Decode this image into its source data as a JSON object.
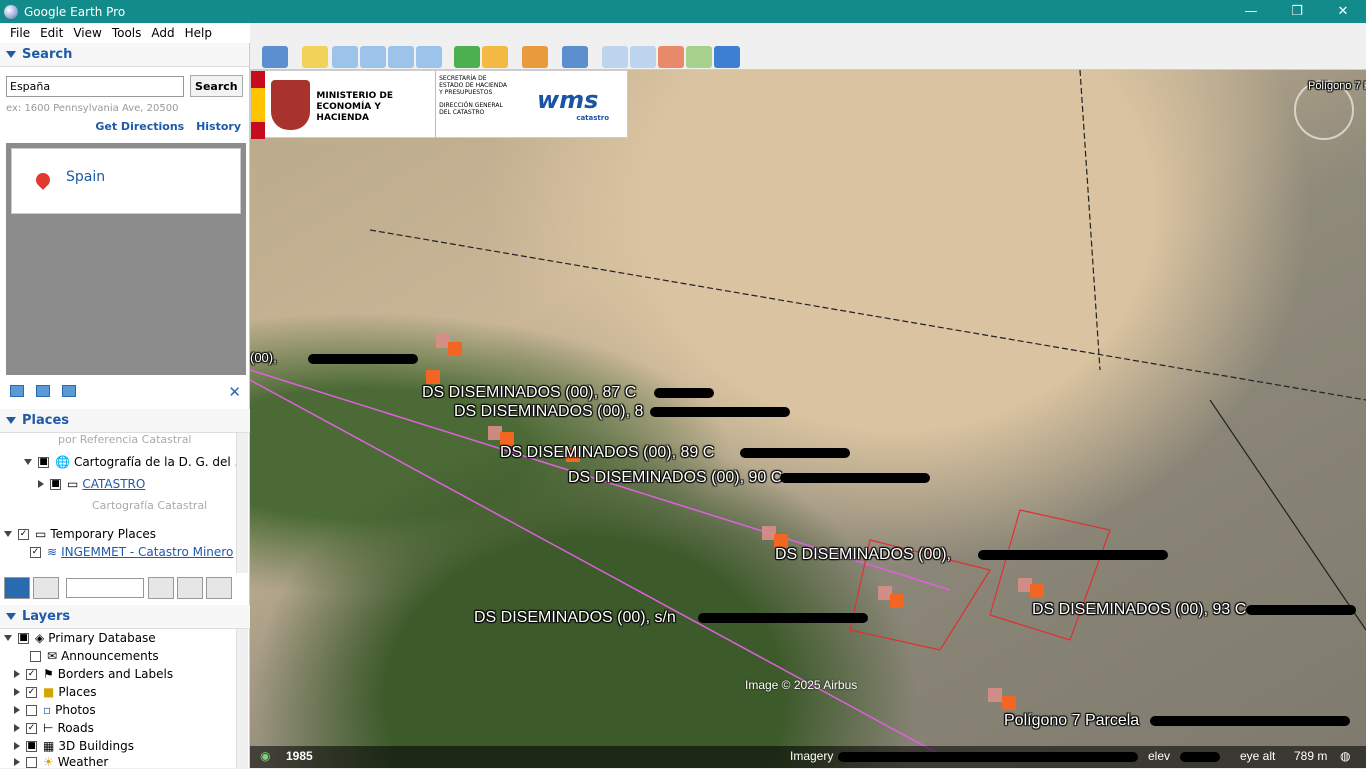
{
  "window": {
    "title": "Google Earth Pro",
    "controls": [
      "—",
      "❐",
      "✕"
    ]
  },
  "menu": [
    "File",
    "Edit",
    "View",
    "Tools",
    "Add",
    "Help"
  ],
  "search": {
    "header": "Search",
    "query": "España",
    "button": "Search",
    "example": "ex: 1600 Pennsylvania Ave, 20500",
    "get_directions": "Get Directions",
    "history": "History",
    "result": "Spain"
  },
  "places": {
    "header": "Places",
    "items": [
      {
        "label": "por Referencia Catastral",
        "type": "grey"
      },
      {
        "label": "Cartografía de la D. G. del ...",
        "checked": "partial"
      },
      {
        "label": "CATASTRO",
        "type": "link"
      },
      {
        "label": "Cartografía Catastral",
        "type": "grey"
      },
      {
        "label": "Temporary Places",
        "checked": "checked"
      },
      {
        "label": "INGEMMET - Catastro Minero",
        "type": "link",
        "checked": "checked"
      }
    ]
  },
  "layers": {
    "header": "Layers",
    "items": [
      {
        "label": "Primary Database",
        "checked": "partial"
      },
      {
        "label": "Announcements",
        "checked": "unchecked"
      },
      {
        "label": "Borders and Labels",
        "checked": "checked"
      },
      {
        "label": "Places",
        "checked": "checked"
      },
      {
        "label": "Photos",
        "checked": "unchecked"
      },
      {
        "label": "Roads",
        "checked": "checked"
      },
      {
        "label": "3D Buildings",
        "checked": "partial"
      },
      {
        "label": "Weather",
        "checked": "unchecked"
      }
    ]
  },
  "banner": {
    "ministry": "MINISTERIO DE ECONOMÍA Y HACIENDA",
    "secretaria": "SECRETARÍA DE ESTADO DE HACIENDA Y PRESUPUESTOS",
    "direccion": "DIRECCIÓN GENERAL DEL CATASTRO",
    "wms": "wms",
    "wms_sub": "catastro"
  },
  "map": {
    "labels": [
      "(00), ",
      "DS DISEMINADOS (00), 87 C",
      "DS DISEMINADOS (00), 8",
      "DS DISEMINADOS (00), 89 C",
      "DS DISEMINADOS (00), 90 C",
      "DS DISEMINADOS (00), ",
      "DS DISEMINADOS (00), s/n",
      "DS DISEMINADOS (00), 93 C",
      "Polígono 7 Parcela",
      "Polígono 7 P"
    ],
    "attribution": "Image © 2025 Airbus"
  },
  "status": {
    "year": "1985",
    "imagery": "Imagery",
    "elev": "elev",
    "eye_alt_label": "eye alt",
    "eye_alt_value": "789 m"
  }
}
